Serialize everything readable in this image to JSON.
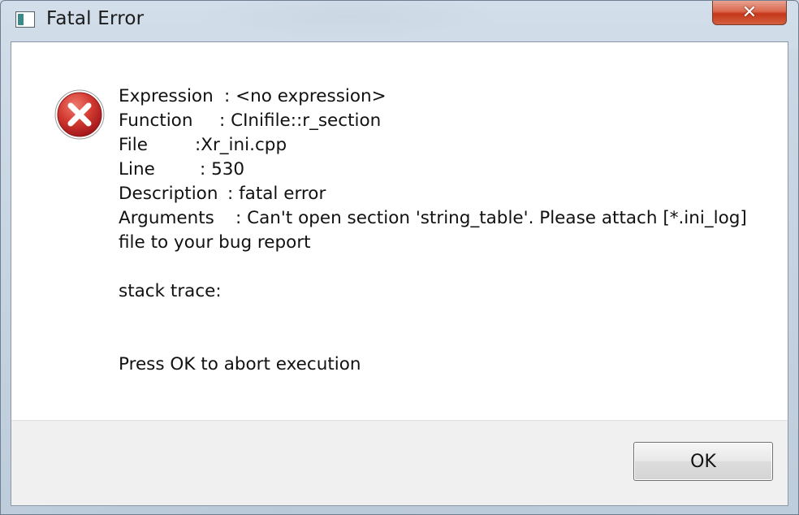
{
  "window": {
    "title": "Fatal Error",
    "close_label": "✕"
  },
  "icons": {
    "app": "application-icon",
    "error": "error-icon"
  },
  "colors": {
    "error_red": "#c8242a",
    "close_red": "#c7371b"
  },
  "message": {
    "expression": {
      "label": "Expression",
      "value": ": <no expression>"
    },
    "function": {
      "label": "Function",
      "value": ": CInifile::r_section"
    },
    "file": {
      "label": "File",
      "value": ":Xr_ini.cpp"
    },
    "line": {
      "label": "Line",
      "value": ": 530"
    },
    "description": {
      "label": "Description",
      "value": ": fatal error"
    },
    "arguments": {
      "label": "Arguments",
      "value": ": Can't open section 'string_table'. Please attach [*.ini_log]"
    },
    "arguments_cont": "file to your bug report",
    "stack_trace": "stack trace:",
    "press_ok": "Press OK to abort execution"
  },
  "buttons": {
    "ok_label": "OK"
  }
}
